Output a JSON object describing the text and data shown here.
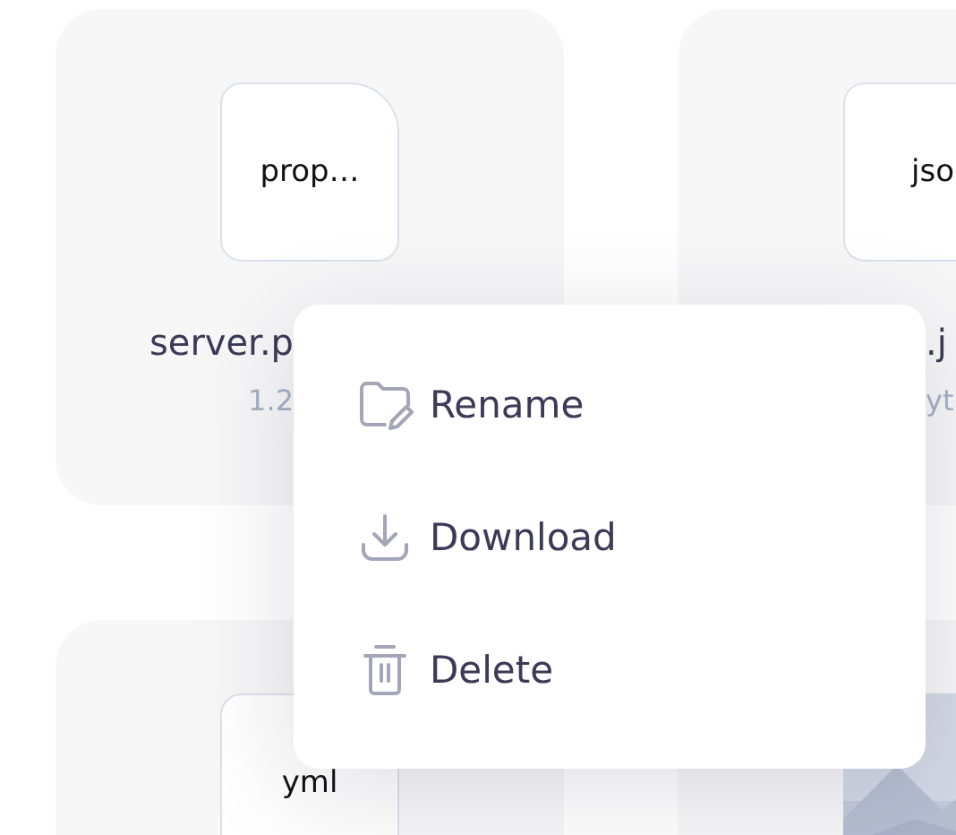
{
  "files": [
    {
      "kind": "document",
      "icon_label": "prop…",
      "name": "server.p",
      "size": "1.2"
    },
    {
      "kind": "document",
      "icon_label": "jso",
      "name": ".j",
      "size": "yt"
    },
    {
      "kind": "document",
      "icon_label": "yml"
    },
    {
      "kind": "picture"
    }
  ],
  "context_menu": {
    "items": [
      {
        "kind": "rename",
        "label": "Rename"
      },
      {
        "kind": "download",
        "label": "Download"
      },
      {
        "kind": "delete",
        "label": "Delete"
      }
    ]
  }
}
